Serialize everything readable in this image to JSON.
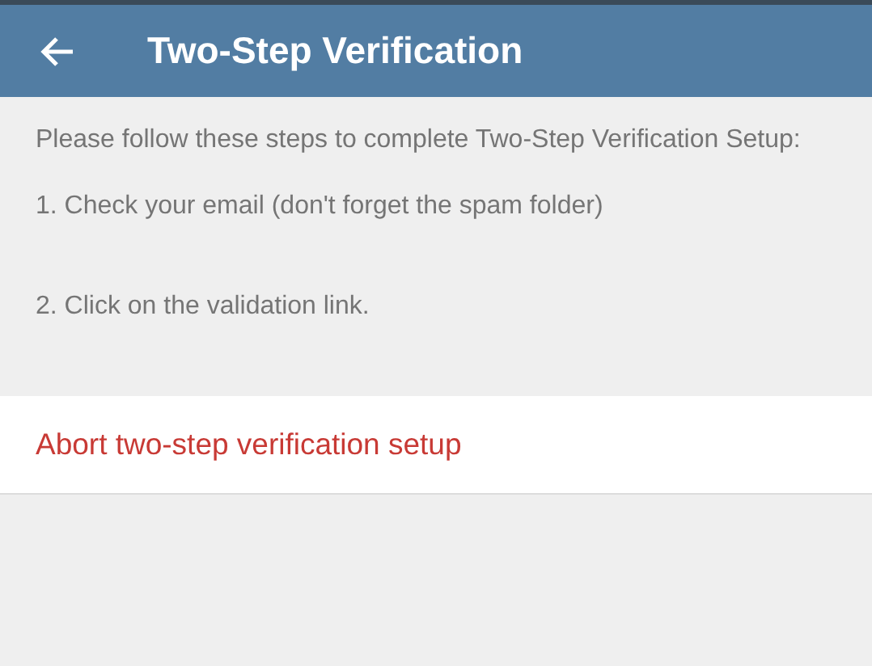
{
  "header": {
    "title": "Two-Step Verification"
  },
  "instructions": [
    "Please follow these steps to complete Two-Step Verification Setup:",
    "1. Check your email (don't forget the spam folder)",
    "2. Click on the validation link."
  ],
  "action": {
    "label": "Abort two-step verification setup"
  }
}
